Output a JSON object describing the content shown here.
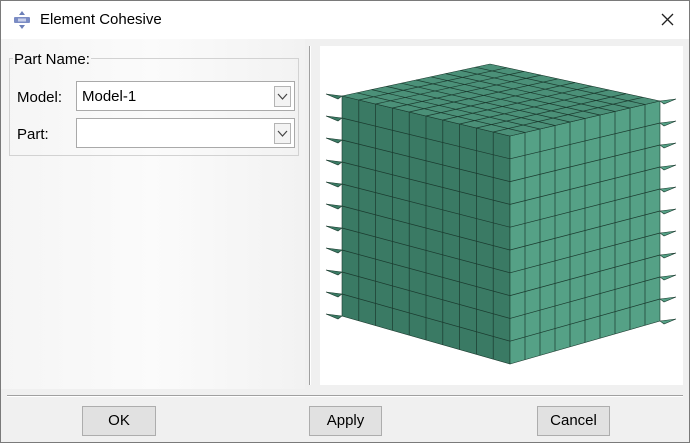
{
  "dialog": {
    "title": "Element Cohesive",
    "icon": "abaqus-plugin-icon",
    "close_icon": "close-icon"
  },
  "part_group": {
    "legend": "Part Name:",
    "model_label": "Model:",
    "model_value": "Model-1",
    "part_label": "Part:",
    "part_value": ""
  },
  "preview": {
    "description_icon": "cohesive-mesh-cube-preview",
    "colors": {
      "front": "#3a7a64",
      "right": "#55a186",
      "top": "#4b9078",
      "edge": "#1a3a2e"
    },
    "grid_divisions": 10
  },
  "buttons": {
    "ok": "OK",
    "apply": "Apply",
    "cancel": "Cancel"
  }
}
